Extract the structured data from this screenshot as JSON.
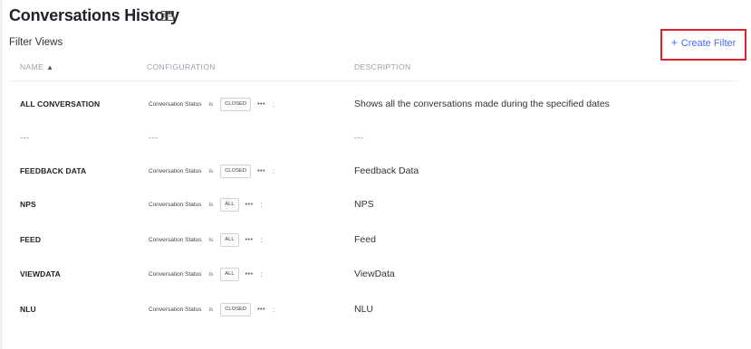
{
  "header": {
    "title": "Conversations History",
    "title_icon": "book-icon",
    "section_label": "Filter Views",
    "create_button_label": "Create Filter",
    "create_button_icon": "plus-icon"
  },
  "columns": {
    "name": "NAME",
    "configuration": "CONFIGURATION",
    "description": "DESCRIPTION",
    "sort_icon": "sort-icon"
  },
  "rows": [
    {
      "name": "ALL CONVERSATION",
      "field": "Conversation Status",
      "op": "is",
      "value": "CLOSED",
      "more": "•••",
      "menu": ":",
      "description": "Shows all the conversations made during the specified dates"
    },
    {
      "name": "---",
      "configuration": "---",
      "description": "---"
    },
    {
      "name": "FEEDBACK DATA",
      "field": "Conversation Status",
      "op": "is",
      "value": "CLOSED",
      "more": "•••",
      "menu": ":",
      "description": "Feedback Data"
    },
    {
      "name": "NPS",
      "field": "Conversation Status",
      "op": "is",
      "value": "ALL",
      "more": "•••",
      "menu": ":",
      "description": "NPS"
    },
    {
      "name": "FEED",
      "field": "Conversation Status",
      "op": "is",
      "value": "ALL",
      "more": "•••",
      "menu": ":",
      "description": "Feed"
    },
    {
      "name": "VIEWDATA",
      "field": "Conversation Status",
      "op": "is",
      "value": "ALL",
      "more": "•••",
      "menu": ":",
      "description": "ViewData"
    },
    {
      "name": "NLU",
      "field": "Conversation Status",
      "op": "is",
      "value": "CLOSED",
      "more": "•••",
      "menu": ":",
      "description": "NLU"
    }
  ],
  "colors": {
    "accent": "#4a6cf7",
    "highlight_border": "#e0202a"
  }
}
